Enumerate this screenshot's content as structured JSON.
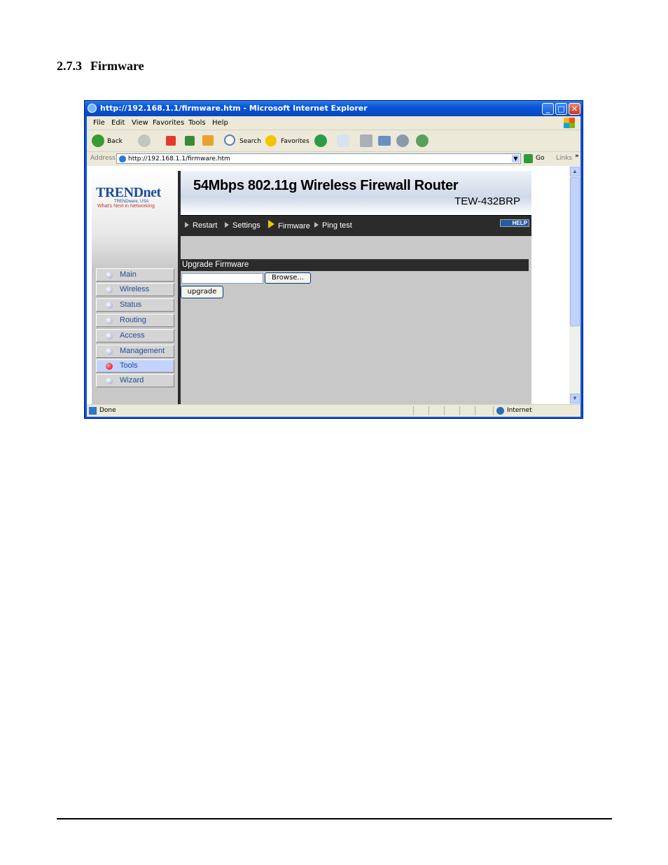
{
  "heading": {
    "number": "2.7.3",
    "title": "Firmware"
  },
  "browser": {
    "title": "http://192.168.1.1/firmware.htm - Microsoft Internet Explorer",
    "menu": [
      "File",
      "Edit",
      "View",
      "Favorites",
      "Tools",
      "Help"
    ],
    "toolbar": {
      "back": "Back",
      "search": "Search",
      "favorites": "Favorites"
    },
    "address_label": "Address",
    "address": "http://192.168.1.1/firmware.htm",
    "go": "Go",
    "links": "Links",
    "status_text": "Done",
    "zone": "Internet"
  },
  "router": {
    "brand": "TRENDnet",
    "brand_sub1": "TRENDware, USA",
    "brand_sub2": "What's Next in Networking",
    "banner_title": "54Mbps 802.11g Wireless Firewall Router",
    "model": "TEW-432BRP",
    "subnav": [
      "Restart",
      "Settings",
      "Firmware",
      "Ping test"
    ],
    "subnav_selected": "Firmware",
    "help": "HELP",
    "sidebar": [
      "Main",
      "Wireless",
      "Status",
      "Routing",
      "Access",
      "Management",
      "Tools",
      "Wizard"
    ],
    "sidebar_active": "Tools",
    "section_title": "Upgrade Firmware",
    "browse_button": "Browse...",
    "upgrade_button": "upgrade"
  }
}
